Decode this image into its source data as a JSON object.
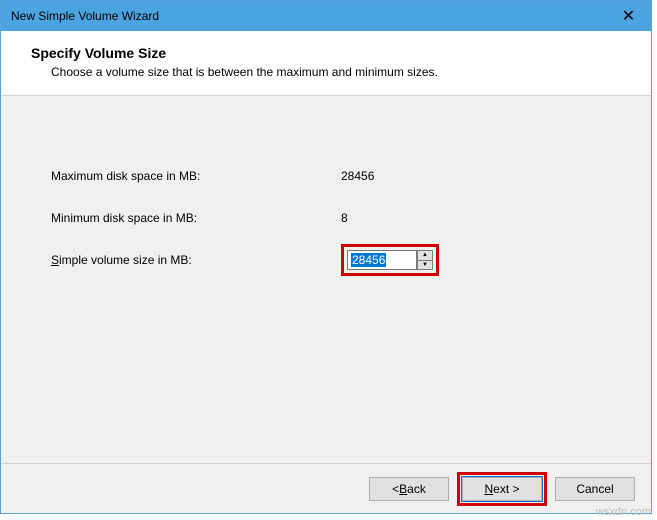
{
  "window": {
    "title": "New Simple Volume Wizard",
    "close_glyph": "✕"
  },
  "header": {
    "title": "Specify Volume Size",
    "subtitle": "Choose a volume size that is between the maximum and minimum sizes."
  },
  "fields": {
    "max_label_text": "Maximum disk space in MB:",
    "max_value": "28456",
    "min_label_text": "Minimum disk space in MB:",
    "min_value": "8",
    "size_label_pre": "S",
    "size_label_post": "imple volume size in MB:",
    "size_value": "28456",
    "spin_up": "▲",
    "spin_down": "▼"
  },
  "buttons": {
    "back_pre": "< ",
    "back_m": "B",
    "back_post": "ack",
    "next_m": "N",
    "next_post": "ext >",
    "cancel": "Cancel"
  },
  "watermark": "wsxdn.com"
}
